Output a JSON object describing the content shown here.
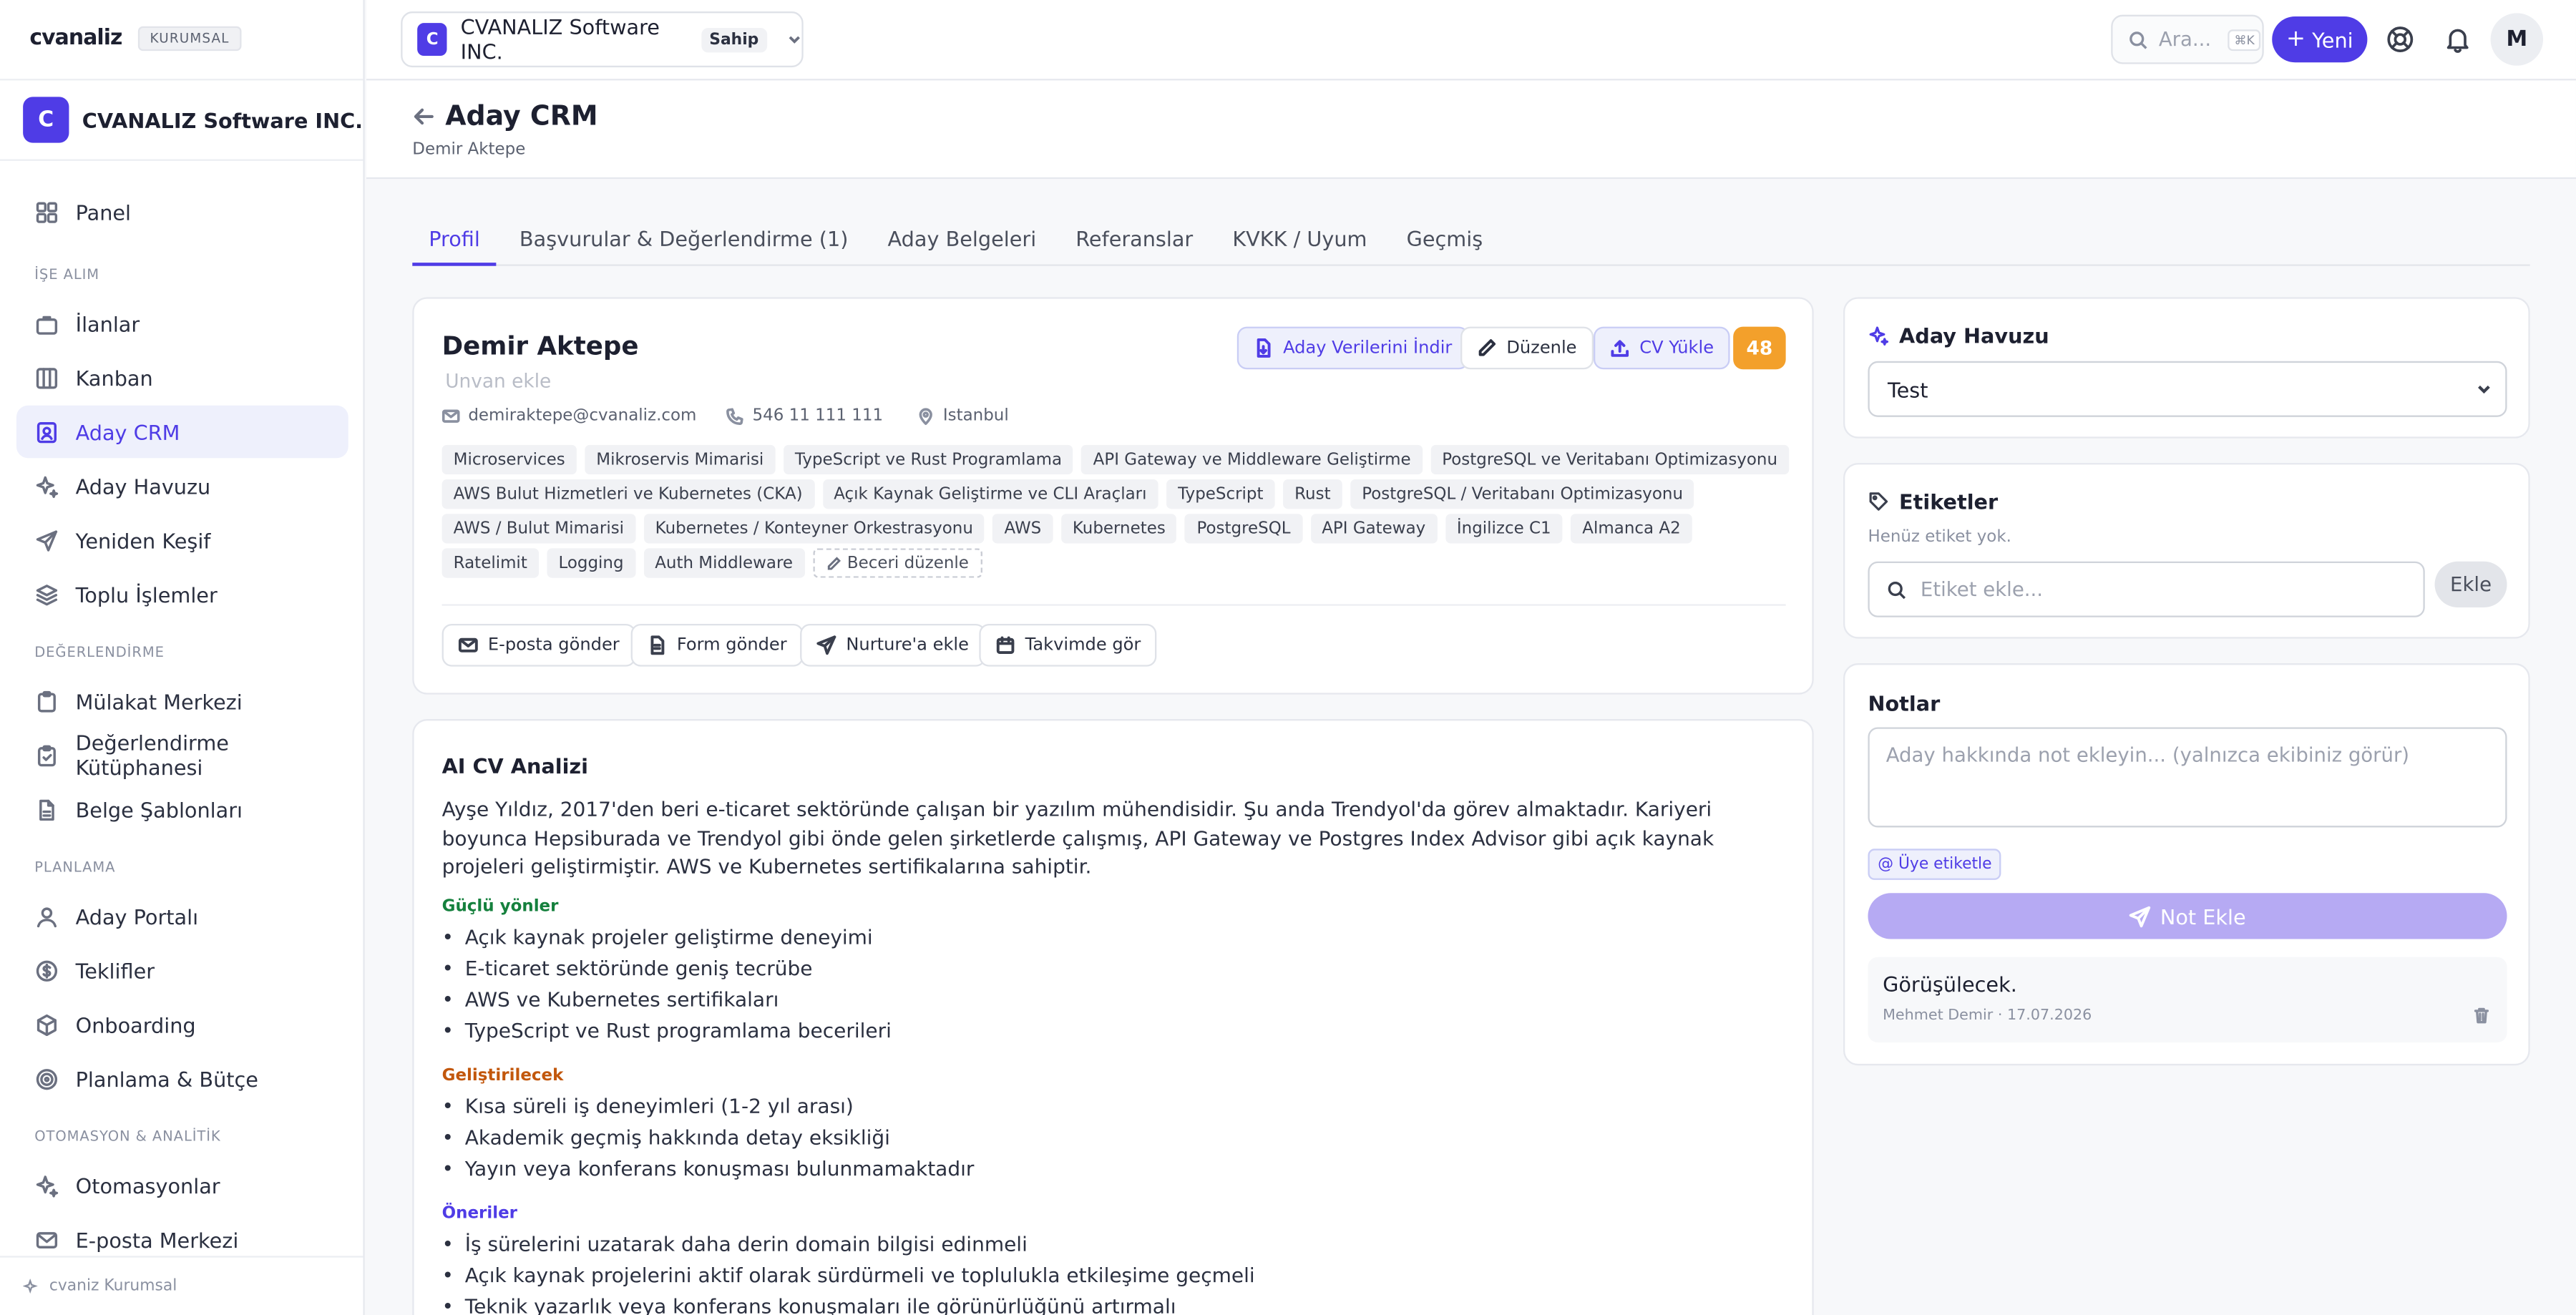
{
  "brand": {
    "logo": "cvanaliz",
    "badge": "KURUMSAL"
  },
  "org": {
    "initial": "C",
    "name": "CVANALIZ Software INC."
  },
  "sidebar": {
    "top_item": "Panel",
    "sections": [
      {
        "title": "İŞE ALIM",
        "items": [
          "İlanlar",
          "Kanban",
          "Aday CRM",
          "Aday Havuzu",
          "Yeniden Keşif",
          "Toplu İşlemler"
        ]
      },
      {
        "title": "DEĞERLENDİRME",
        "items": [
          "Mülakat Merkezi",
          "Değerlendirme Kütüphanesi",
          "Belge Şablonları"
        ]
      },
      {
        "title": "PLANLAMA",
        "items": [
          "Aday Portalı",
          "Teklifler",
          "Onboarding",
          "Planlama & Bütçe"
        ]
      },
      {
        "title": "OTOMASYON & ANALİTİK",
        "items": [
          "Otomasyonlar",
          "E-posta Merkezi"
        ]
      }
    ],
    "active_item": "Aday CRM",
    "footer": "cvaniz Kurumsal"
  },
  "topbar": {
    "org_initial": "C",
    "org_name": "CVANALIZ Software INC.",
    "role": "Sahip",
    "search_placeholder": "Ara...",
    "search_shortcut": "⌘K",
    "new_label": "Yeni",
    "user_initial": "M"
  },
  "page": {
    "title": "Aday CRM",
    "subtitle": "Demir Aktepe"
  },
  "tabs": [
    "Profil",
    "Başvurular & Değerlendirme (1)",
    "Aday Belgeleri",
    "Referanslar",
    "KVKK / Uyum",
    "Geçmiş"
  ],
  "active_tab": "Profil",
  "candidate": {
    "name": "Demir Aktepe",
    "title_placeholder": "Unvan ekle",
    "email": "demiraktepe@cvanaliz.com",
    "phone": "546 11 111 111",
    "location": "Istanbul",
    "score": "48",
    "actions": {
      "download": "Aday Verilerini İndir",
      "edit": "Düzenle",
      "upload": "CV Yükle"
    },
    "skills": [
      "Microservices",
      "Mikroservis Mimarisi",
      "TypeScript ve Rust Programlama",
      "API Gateway ve Middleware Geliştirme",
      "PostgreSQL ve Veritabanı Optimizasyonu",
      "AWS Bulut Hizmetleri ve Kubernetes (CKA)",
      "Açık Kaynak Geliştirme ve CLI Araçları",
      "TypeScript",
      "Rust",
      "PostgreSQL / Veritabanı Optimizasyonu",
      "AWS / Bulut Mimarisi",
      "Kubernetes / Konteyner Orkestrasyonu",
      "AWS",
      "Kubernetes",
      "PostgreSQL",
      "API Gateway",
      "İngilizce C1",
      "Almanca A2",
      "Ratelimit",
      "Logging",
      "Auth Middleware"
    ],
    "edit_skills": "Beceri düzenle",
    "bottom_actions": [
      "E-posta gönder",
      "Form gönder",
      "Nurture'a ekle",
      "Takvimde gör"
    ]
  },
  "ai": {
    "title": "AI CV Analizi",
    "summary": "Ayşe Yıldız, 2017'den beri e-ticaret sektöründe çalışan bir yazılım mühendisidir. Şu anda Trendyol'da görev almaktadır. Kariyeri boyunca Hepsiburada ve Trendyol gibi önde gelen şirketlerde çalışmış, API Gateway ve Postgres Index Advisor gibi açık kaynak projeleri geliştirmiştir. AWS ve Kubernetes sertifikalarına sahiptir.",
    "strengths_title": "Güçlü yönler",
    "strengths": [
      "Açık kaynak projeler geliştirme deneyimi",
      "E-ticaret sektöründe geniş tecrübe",
      "AWS ve Kubernetes sertifikaları",
      "TypeScript ve Rust programlama becerileri"
    ],
    "improve_title": "Geliştirilecek",
    "improve": [
      "Kısa süreli iş deneyimleri (1-2 yıl arası)",
      "Akademik geçmiş hakkında detay eksikliği",
      "Yayın veya konferans konuşması bulunmamaktadır"
    ],
    "suggest_title": "Öneriler",
    "suggest": [
      "İş sürelerini uzatarak daha derin domain bilgisi edinmeli",
      "Açık kaynak projelerini aktif olarak sürdürmeli ve toplulukla etkileşime geçmeli",
      "Teknik yazarlık veya konferans konuşmaları ile görünürlüğünü artırmalı"
    ]
  },
  "pool": {
    "title": "Aday Havuzu",
    "selected": "Test"
  },
  "tags": {
    "title": "Etiketler",
    "empty": "Henüz etiket yok.",
    "placeholder": "Etiket ekle...",
    "add": "Ekle"
  },
  "notes": {
    "title": "Notlar",
    "placeholder": "Aday hakkında not ekleyin... (yalnızca ekibiniz görür)",
    "mention": "@ Üye etiketle",
    "add": "Not Ekle",
    "items": [
      {
        "text": "Görüşülecek.",
        "author": "Mehmet Demir",
        "date": "17.07.2026"
      }
    ]
  },
  "colors": {
    "accent": "#4f3ce6",
    "score": "#f3a02b",
    "strength": "#15803d",
    "improve": "#c2570c"
  }
}
